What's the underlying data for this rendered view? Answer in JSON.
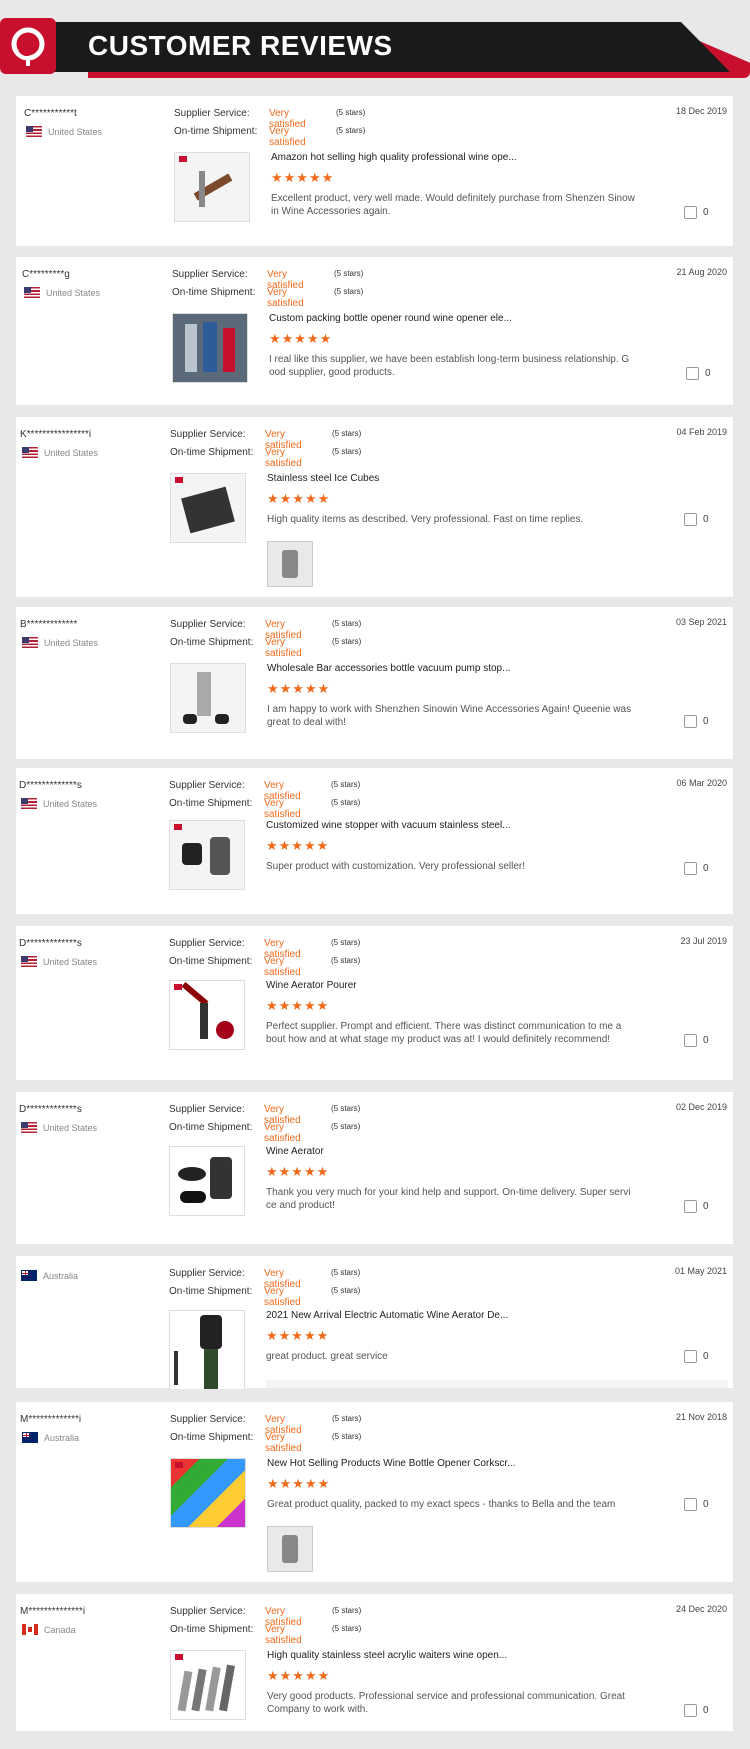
{
  "header": {
    "title": "CUSTOMER REVIEWS"
  },
  "colors": {
    "accent": "#f26a1b",
    "brand_red": "#c8102e",
    "header_black": "#1a1a1a"
  },
  "labels": {
    "supplier_service": "Supplier Service:",
    "on_time": "On-time Shipment:"
  },
  "reviews": [
    {
      "user": "C***********t",
      "country": "United States",
      "date": "18 Dec 2019",
      "service_rating": "Very satisfied",
      "service_stars": "(5 stars)",
      "shipment_rating": "Very satisfied",
      "shipment_stars": "(5 stars)",
      "product_title": "Amazon hot selling high quality professional wine ope...",
      "stars": "★★★★★",
      "comment": "Excellent product, very well made. Would definitely purchase from Shenzen Sinow in Wine Accessories again.",
      "likes": "0"
    },
    {
      "user": "C*********g",
      "country": "United States",
      "date": "21 Aug 2020",
      "service_rating": "Very satisfied",
      "service_stars": "(5 stars)",
      "shipment_rating": "Very satisfied",
      "shipment_stars": "(5 stars)",
      "product_title": "Custom packing bottle opener round wine opener ele...",
      "stars": "★★★★★",
      "comment": "I real like this supplier, we have been establish long-term business relationship. G ood supplier, good products.",
      "likes": "0"
    },
    {
      "user": "K****************i",
      "country": "United States",
      "date": "04 Feb 2019",
      "service_rating": "Very satisfied",
      "service_stars": "(5 stars)",
      "shipment_rating": "Very satisfied",
      "shipment_stars": "(5 stars)",
      "product_title": "Stainless steel Ice Cubes",
      "stars": "★★★★★",
      "comment": "High quality items as described. Very professional. Fast on time replies.",
      "likes": "0"
    },
    {
      "user": "B*************",
      "country": "United States",
      "date": "03 Sep 2021",
      "service_rating": "Very satisfied",
      "service_stars": "(5 stars)",
      "shipment_rating": "Very satisfied",
      "shipment_stars": "(5 stars)",
      "product_title": "Wholesale Bar accessories bottle vacuum pump stop...",
      "stars": "★★★★★",
      "comment": "I am happy to work with Shenzhen Sinowin Wine Accessories Again! Queenie was great to deal with!",
      "likes": "0"
    },
    {
      "user": "D*************s",
      "country": "United States",
      "date": "06 Mar 2020",
      "service_rating": "Very satisfied",
      "service_stars": "(5 stars)",
      "shipment_rating": "Very satisfied",
      "shipment_stars": "(5 stars)",
      "product_title": "Customized wine stopper with vacuum stainless steel...",
      "stars": "★★★★★",
      "comment": "Super product with customization. Very professional seller!",
      "likes": "0"
    },
    {
      "user": "D*************s",
      "country": "United States",
      "date": "23 Jul 2019",
      "service_rating": "Very satisfied",
      "service_stars": "(5 stars)",
      "shipment_rating": "Very satisfied",
      "shipment_stars": "(5 stars)",
      "product_title": "Wine Aerator Pourer",
      "stars": "★★★★★",
      "comment": "Perfect supplier. Prompt and efficient. There was distinct communication to me a bout how and at what stage my product was at! I would definitely recommend!",
      "likes": "0"
    },
    {
      "user": "D*************s",
      "country": "United States",
      "date": "02 Dec 2019",
      "service_rating": "Very satisfied",
      "service_stars": "(5 stars)",
      "shipment_rating": "Very satisfied",
      "shipment_stars": "(5 stars)",
      "product_title": "Wine Aerator",
      "stars": "★★★★★",
      "comment": "Thank you very much for your kind help and support. On-time delivery. Super servi ce and product!",
      "likes": "0"
    },
    {
      "user": "",
      "country": "Australia",
      "date": "01 May 2021",
      "service_rating": "Very satisfied",
      "service_stars": "(5 stars)",
      "shipment_rating": "Very satisfied",
      "shipment_stars": "(5 stars)",
      "product_title": "2021 New Arrival Electric Automatic Wine Aerator De...",
      "stars": "★★★★★",
      "comment": "great product. great service",
      "likes": "0"
    },
    {
      "user": "M*************i",
      "country": "Australia",
      "date": "21 Nov 2018",
      "service_rating": "Very satisfied",
      "service_stars": "(5 stars)",
      "shipment_rating": "Very satisfied",
      "shipment_stars": "(5 stars)",
      "product_title": "New Hot Selling Products Wine Bottle Opener Corkscr...",
      "stars": "★★★★★",
      "comment": "Great product quality, packed to my exact specs - thanks to Bella and the team",
      "likes": "0"
    },
    {
      "user": "M**************i",
      "country": "Canada",
      "date": "24 Dec 2020",
      "service_rating": "Very satisfied",
      "service_stars": "(5 stars)",
      "shipment_rating": "Very satisfied",
      "shipment_stars": "(5 stars)",
      "product_title": "High quality stainless steel acrylic waiters wine open...",
      "stars": "★★★★★",
      "comment": "Very good products. Professional service and professional communication. Great Company to work with.",
      "likes": "0"
    }
  ]
}
